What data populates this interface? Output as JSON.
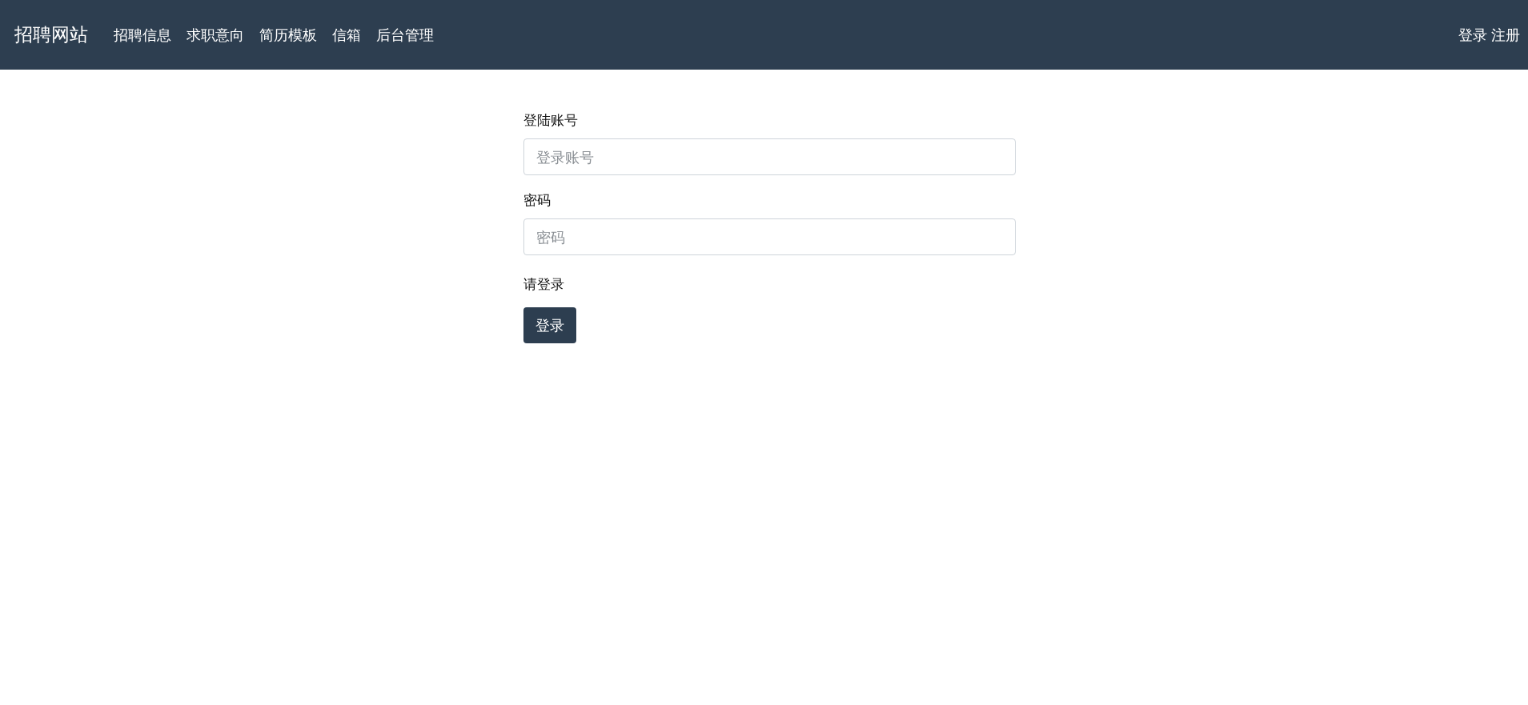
{
  "navbar": {
    "brand": "招聘网站",
    "links": [
      "招聘信息",
      "求职意向",
      "简历模板",
      "信箱",
      "后台管理"
    ],
    "account_links": [
      "登录",
      "注册"
    ]
  },
  "form": {
    "fields": [
      {
        "label": "登陆账号",
        "placeholder": "登录账号"
      },
      {
        "label": "密码",
        "placeholder": "密码"
      }
    ],
    "message": "请登录",
    "submit": "登录"
  }
}
